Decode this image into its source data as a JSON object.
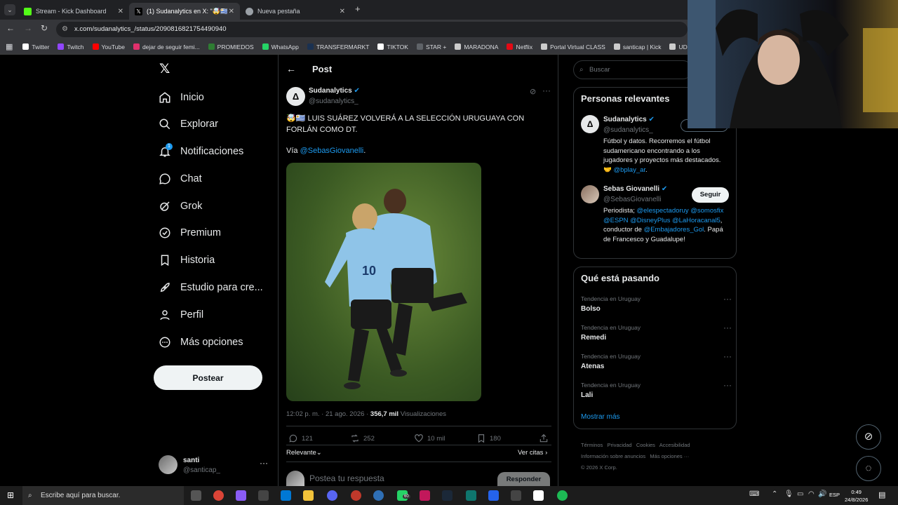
{
  "browser": {
    "tabs": [
      {
        "title": "Stream - Kick Dashboard",
        "color": "#53fc18"
      },
      {
        "title": "(1) Sudanalytics en X: \"🤯🇺🇾 LU",
        "color": "#ffffff"
      },
      {
        "title": "Nueva pestaña",
        "color": "#9aa0a6"
      }
    ],
    "url": "x.com/sudanalytics_/status/2090816821754490940",
    "bookmarks": [
      {
        "label": "Twitter",
        "color": "#ffffff"
      },
      {
        "label": "Twitch",
        "color": "#9146ff"
      },
      {
        "label": "YouTube",
        "color": "#ff0000"
      },
      {
        "label": "dejar de seguir femi...",
        "color": "#e1306c"
      },
      {
        "label": "PROMIEDOS",
        "color": "#2e7d32"
      },
      {
        "label": "WhatsApp",
        "color": "#25d366"
      },
      {
        "label": "TRANSFERMARKT",
        "color": "#1a3151"
      },
      {
        "label": "TIKTOK",
        "color": "#ffffff"
      },
      {
        "label": "STAR +",
        "color": "#5f6368"
      },
      {
        "label": "MARADONA",
        "color": "#cccccc"
      },
      {
        "label": "Netflix",
        "color": "#e50914"
      },
      {
        "label": "Portal Virtual CLASS",
        "color": "#cccccc"
      },
      {
        "label": "santicap | Kick",
        "color": "#cccccc"
      },
      {
        "label": "UDE",
        "color": "#cccccc"
      },
      {
        "label": "Sup",
        "color": "#e53935"
      }
    ]
  },
  "nav": {
    "items": [
      {
        "label": "Inicio",
        "icon": "home-icon"
      },
      {
        "label": "Explorar",
        "icon": "search-icon"
      },
      {
        "label": "Notificaciones",
        "icon": "bell-icon"
      },
      {
        "label": "Chat",
        "icon": "chat-icon"
      },
      {
        "label": "Grok",
        "icon": "grok-icon"
      },
      {
        "label": "Premium",
        "icon": "verified-icon"
      },
      {
        "label": "Historia",
        "icon": "bookmark-icon"
      },
      {
        "label": "Estudio para cre...",
        "icon": "rocket-icon"
      },
      {
        "label": "Perfil",
        "icon": "person-icon"
      },
      {
        "label": "Más opciones",
        "icon": "more-circle-icon"
      }
    ],
    "notif_badge": "1",
    "post_button": "Postear",
    "user": {
      "name": "santi",
      "handle": "@santicap_"
    }
  },
  "post": {
    "header": "Post",
    "author": "Sudanalytics",
    "handle": "@sudanalytics_",
    "text_emojis": "🤯🇺🇾",
    "text_line1": "LUIS SUÁREZ VOLVERÁ A LA SELECCIÓN URUGUAYA CON",
    "text_line2": "FORLÁN COMO DT.",
    "via_prefix": "Vía ",
    "via_link": "@SebasGiovanelli",
    "via_suffix": ".",
    "time": "12:02 p. m. · 21 ago. 2026",
    "views_count": "356,7 mil",
    "views_label": "Visualizaciones",
    "replies": "121",
    "reposts": "252",
    "likes": "10 mil",
    "bookmarks": "180",
    "sort_label": "Relevante",
    "quotes_label": "Ver citas",
    "reply_placeholder": "Postea tu respuesta",
    "reply_button": "Responder"
  },
  "sidebar": {
    "search_placeholder": "Buscar",
    "relevant_title": "Personas relevantes",
    "people": [
      {
        "name": "Sudanalytics",
        "handle": "@sudanalytics_",
        "bio_text": "Fútbol y datos. Recorremos el fútbol sudamericano encontrando a los jugadores y proyectos más destacados. 🤝 ",
        "bio_link": "@bplay_ar",
        "bio_end": "."
      },
      {
        "name": "Sebas Giovanelli",
        "handle": "@SebasGiovanelli",
        "follow": "Seguir",
        "bio_start": "Periodista; ",
        "bio_links": "@elespectadoruy @somosfix @ESPN @DisneyPlus @LaHoracanal5",
        "bio_mid": ", conductor de ",
        "bio_link2": "@Embajadores_Gol",
        "bio_end": ". Papá de Francesco y Guadalupe!"
      }
    ],
    "trending_title": "Qué está pasando",
    "trends": [
      {
        "category": "Tendencia en Uruguay",
        "name": "Bolso"
      },
      {
        "category": "Tendencia en Uruguay",
        "name": "Remedi"
      },
      {
        "category": "Tendencia en Uruguay",
        "name": "Atenas"
      },
      {
        "category": "Tendencia en Uruguay",
        "name": "Lali"
      }
    ],
    "show_more": "Mostrar más",
    "footer": [
      "Términos",
      "Privacidad",
      "Cookies",
      "Accesibilidad",
      "Información sobre anuncios",
      "Más opciones ···",
      "© 2026 X Corp."
    ]
  },
  "taskbar": {
    "search_placeholder": "Escribe aquí para buscar.",
    "lang": "ESP",
    "time": "0:49",
    "date": "24/8/2026",
    "badge": "60"
  },
  "colors": {
    "accent": "#1d9bf0",
    "verified": "#1d9bf0",
    "background": "#000000"
  }
}
